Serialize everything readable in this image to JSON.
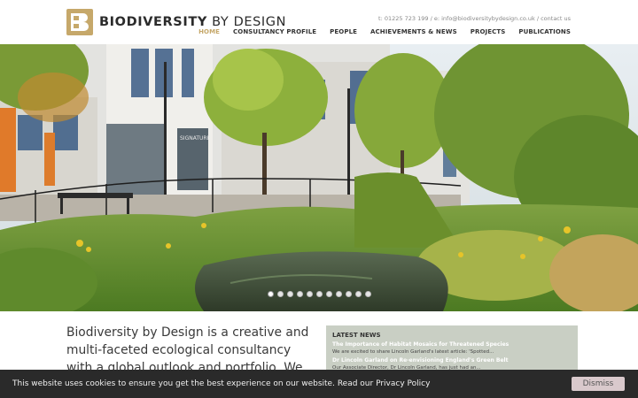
{
  "brand": {
    "name_bold": "BIODIVERSITY",
    "name_light": "BY DESIGN",
    "monogram": "B",
    "logo_color": "#c6a86a"
  },
  "header": {
    "contact_phone": "t: 01225 723 199",
    "contact_separator": "/",
    "contact_email": "e: info@biodiversitybydesign.co.uk",
    "contact_link": "contact us"
  },
  "nav": {
    "items": [
      {
        "label": "HOME",
        "active": true
      },
      {
        "label": "CONSULTANCY PROFILE",
        "active": false
      },
      {
        "label": "PEOPLE",
        "active": false
      },
      {
        "label": "ACHIEVEMENTS & NEWS",
        "active": false
      },
      {
        "label": "PROJECTS",
        "active": false
      },
      {
        "label": "PUBLICATIONS",
        "active": false
      }
    ]
  },
  "hero": {
    "slide_count": 11,
    "active_slide": 1,
    "shop_sign": "SIGNATURE"
  },
  "intro": {
    "text": "Biodiversity by Design is a creative and multi-faceted ecological consultancy with a global outlook and portfolio. We seek to add value to"
  },
  "news": {
    "heading": "LATEST NEWS",
    "items": [
      {
        "title": "The Importance of Habitat Mosaics for Threatened Species",
        "excerpt": "We are excited to share Lincoln Garland's latest article: 'Spotted..."
      },
      {
        "title": "Dr Lincoln Garland on Re-envisioning England's Green Belt",
        "excerpt": "Our Associate Director, Dr Lincoln Garland, has just had an..."
      }
    ]
  },
  "cookie": {
    "message": "This website uses cookies to ensure you get the best experience on our website. Read our Privacy Policy",
    "dismiss_label": "Dismiss"
  }
}
